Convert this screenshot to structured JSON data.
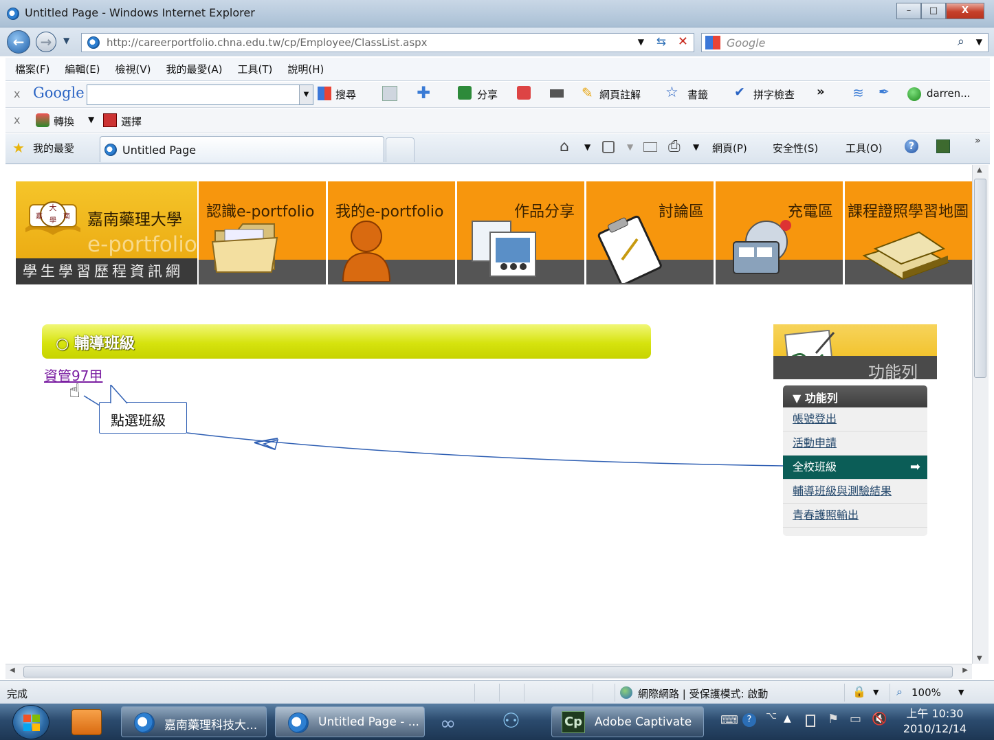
{
  "window": {
    "title": "Untitled Page - Windows Internet Explorer",
    "controls": {
      "minimize": "–",
      "maximize": "□",
      "close": "X"
    }
  },
  "address_bar": {
    "url": "http://careerportfolio.chna.edu.tw/cp/Employee/ClassList.aspx",
    "search_placeholder": "Google"
  },
  "menu": [
    "檔案(F)",
    "編輯(E)",
    "檢視(V)",
    "我的最愛(A)",
    "工具(T)",
    "說明(H)"
  ],
  "google_toolbar": {
    "close": "x",
    "logo": "Google",
    "search": "搜尋",
    "share": "分享",
    "annotate": "網頁註解",
    "bookmarks": "書籤",
    "spellcheck": "拼字檢查",
    "more": "»",
    "user": "darren..."
  },
  "ez_bar": {
    "close": "x",
    "convert": "轉換",
    "select": "選擇"
  },
  "tab_row": {
    "favorites": "我的最愛",
    "tab_title": "Untitled Page",
    "page_menu": "網頁(P)",
    "safety_menu": "安全性(S)",
    "tools_menu": "工具(O)",
    "more": "»"
  },
  "site": {
    "university": "嘉南藥理大學",
    "eportfolio": "e-portfolio",
    "subtitle": "學生學習歷程資訊網",
    "seal_chars": [
      "大",
      "嘉",
      "南",
      "學"
    ],
    "nav": [
      "認識e-portfolio",
      "我的e-portfolio",
      "作品分享",
      "討論區",
      "充電區",
      "課程證照學習地圖"
    ]
  },
  "section": {
    "title": "輔導班級",
    "class_link": "資管97甲",
    "callout": "點選班級"
  },
  "function_panel": {
    "title": "功能列",
    "menu_header": "▼ 功能列",
    "items": [
      "帳號登出",
      "活動申請",
      "全校班級",
      "輔導班級與測驗結果",
      "青春護照輸出"
    ],
    "active_index": 2
  },
  "status_bar": {
    "status": "完成",
    "zone": "網際網路 | 受保護模式: 啟動",
    "zoom": "100%"
  },
  "taskbar": {
    "buttons": [
      "嘉南藥理科技大...",
      "Untitled Page - ...",
      "Adobe Captivate"
    ],
    "time": "上午 10:30",
    "date": "2010/12/14"
  }
}
